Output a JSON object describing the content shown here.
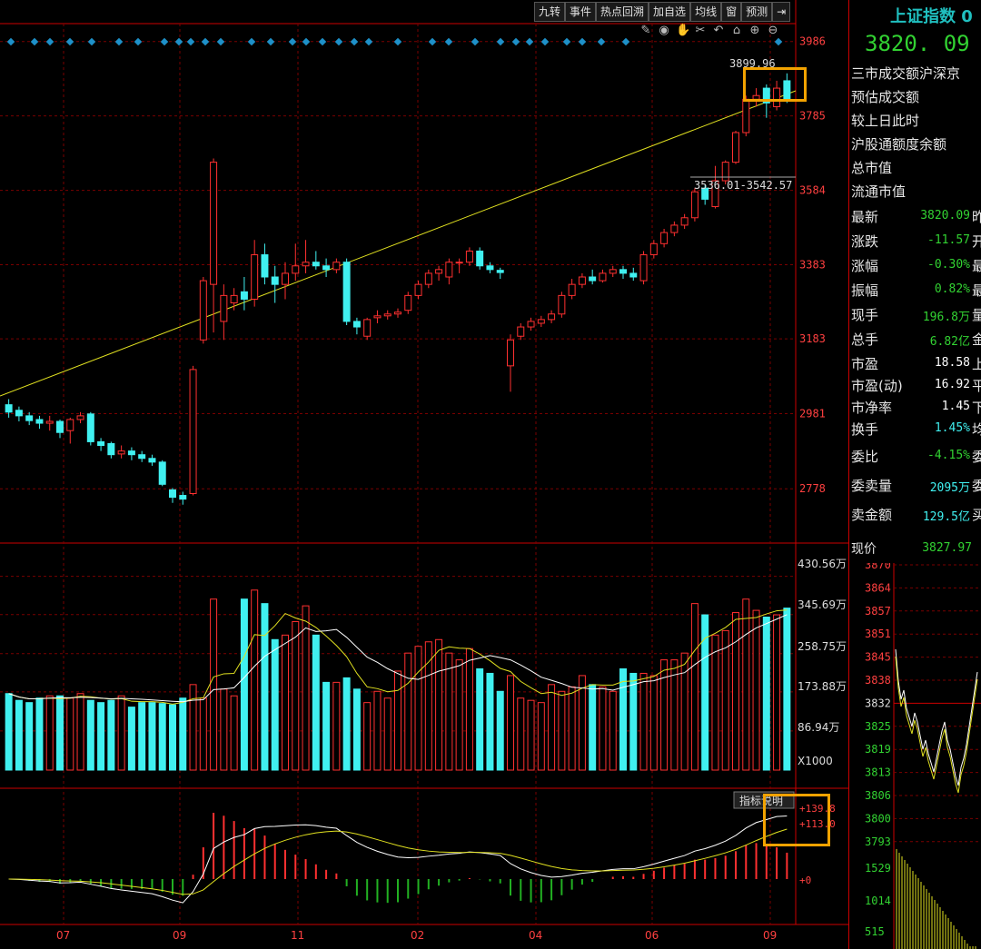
{
  "toolbar": [
    "九转",
    "事件",
    "热点回溯",
    "加自选",
    "均线",
    "窗",
    "预测"
  ],
  "tools": [
    "pen-icon",
    "eye-icon",
    "hand-icon",
    "scissors-icon",
    "undo-icon",
    "lock-icon",
    "zoom-in-icon",
    "zoom-out-icon"
  ],
  "colors": {
    "up": "#ff3030",
    "down": "#40f0f0",
    "green": "#32d232",
    "grid": "#7a0000",
    "ma1": "#ffffff",
    "ma2": "#e0e020"
  },
  "panel": {
    "title": "上证指数 0",
    "price": "3820. 09",
    "info_labels": [
      "三市成交额沪深京",
      "预估成交额",
      "较上日此时",
      "沪股通额度余额",
      "总市值",
      "流通市值"
    ],
    "quotes": [
      {
        "label": "最新",
        "value": "3820.09",
        "color": "green",
        "suffix": "昨"
      },
      {
        "label": "涨跌",
        "value": "-11.57",
        "color": "green",
        "suffix": "开"
      },
      {
        "label": "涨幅",
        "value": "-0.30%",
        "color": "green",
        "suffix": "最"
      },
      {
        "label": "振幅",
        "value": "0.82%",
        "color": "green",
        "suffix": "最"
      },
      {
        "label": "现手",
        "value": "196.8万",
        "color": "green",
        "suffix": "量"
      },
      {
        "label": "总手",
        "value": "6.82亿",
        "color": "green",
        "suffix": "金"
      },
      {
        "label": "市盈",
        "value": "18.58",
        "color": "white",
        "suffix": "上"
      },
      {
        "label": "市盈(动)",
        "value": "16.92",
        "color": "white",
        "suffix": "平"
      },
      {
        "label": "市净率",
        "value": "1.45",
        "color": "white",
        "suffix": "下"
      },
      {
        "label": "换手",
        "value": "1.45%",
        "color": "cyan",
        "suffix": "均"
      },
      {
        "label": "委比",
        "value": "-4.15%",
        "color": "green",
        "suffix": "委"
      },
      {
        "label": "委卖量",
        "value": "2095万",
        "color": "cyan",
        "suffix": "委"
      },
      {
        "label": "卖金额",
        "value": "129.5亿",
        "color": "cyan",
        "suffix": "买"
      }
    ],
    "mini_price_label": "现价",
    "mini_price": "3827.97",
    "mini_price_axis": [
      "3870",
      "3864",
      "3857",
      "3851",
      "3845",
      "3838",
      "3832",
      "3825",
      "3819",
      "3813",
      "3806",
      "3800",
      "3793"
    ],
    "mini_vol_axis": [
      "1529",
      "1014",
      "515"
    ]
  },
  "chart_data": {
    "type": "candlestick",
    "price_axis": [
      "3986",
      "3785",
      "3584",
      "3383",
      "3183",
      "2981",
      "2778"
    ],
    "price_range": [
      2700,
      4000
    ],
    "annotations": {
      "high_label": "3899.96",
      "gap_label": "3536.01-3542.57"
    },
    "x_labels": [
      "07",
      "09",
      "11",
      "02",
      "04",
      "06",
      "09"
    ],
    "volume_axis": [
      "430.56万",
      "345.69万",
      "258.75万",
      "173.88万",
      "86.94万",
      "X1000"
    ],
    "volume_range": [
      0,
      450
    ],
    "macd_labels": [
      "+139.8",
      "+113.0",
      "+0"
    ],
    "macd_button": "指标说明",
    "candles": [
      {
        "o": 3005,
        "c": 2985,
        "h": 3020,
        "l": 2970,
        "v": 170
      },
      {
        "o": 2990,
        "c": 2975,
        "h": 3000,
        "l": 2960,
        "v": 155
      },
      {
        "o": 2975,
        "c": 2962,
        "h": 2985,
        "l": 2950,
        "v": 150
      },
      {
        "o": 2965,
        "c": 2955,
        "h": 2975,
        "l": 2940,
        "v": 160
      },
      {
        "o": 2955,
        "c": 2960,
        "h": 2975,
        "l": 2935,
        "v": 165
      },
      {
        "o": 2960,
        "c": 2930,
        "h": 2965,
        "l": 2915,
        "v": 165
      },
      {
        "o": 2935,
        "c": 2965,
        "h": 2970,
        "l": 2900,
        "v": 160
      },
      {
        "o": 2965,
        "c": 2975,
        "h": 2985,
        "l": 2955,
        "v": 170
      },
      {
        "o": 2980,
        "c": 2905,
        "h": 2985,
        "l": 2895,
        "v": 155
      },
      {
        "o": 2905,
        "c": 2895,
        "h": 2915,
        "l": 2880,
        "v": 150
      },
      {
        "o": 2900,
        "c": 2870,
        "h": 2905,
        "l": 2860,
        "v": 155
      },
      {
        "o": 2872,
        "c": 2880,
        "h": 2895,
        "l": 2860,
        "v": 165
      },
      {
        "o": 2880,
        "c": 2870,
        "h": 2890,
        "l": 2855,
        "v": 140
      },
      {
        "o": 2870,
        "c": 2860,
        "h": 2880,
        "l": 2850,
        "v": 150
      },
      {
        "o": 2860,
        "c": 2850,
        "h": 2870,
        "l": 2840,
        "v": 150
      },
      {
        "o": 2850,
        "c": 2790,
        "h": 2855,
        "l": 2785,
        "v": 148
      },
      {
        "o": 2775,
        "c": 2755,
        "h": 2780,
        "l": 2740,
        "v": 145
      },
      {
        "o": 2760,
        "c": 2750,
        "h": 2770,
        "l": 2735,
        "v": 160
      },
      {
        "o": 2765,
        "c": 3100,
        "h": 3110,
        "l": 2760,
        "v": 190
      },
      {
        "o": 3180,
        "c": 3340,
        "h": 3350,
        "l": 3170,
        "v": 160
      },
      {
        "o": 3330,
        "c": 3660,
        "h": 3670,
        "l": 3200,
        "v": 380
      },
      {
        "o": 3230,
        "c": 3300,
        "h": 3330,
        "l": 3180,
        "v": 180
      },
      {
        "o": 3280,
        "c": 3300,
        "h": 3320,
        "l": 3260,
        "v": 165
      },
      {
        "o": 3310,
        "c": 3290,
        "h": 3350,
        "l": 3260,
        "v": 380
      },
      {
        "o": 3290,
        "c": 3410,
        "h": 3450,
        "l": 3270,
        "v": 400
      },
      {
        "o": 3410,
        "c": 3350,
        "h": 3440,
        "l": 3330,
        "v": 370
      },
      {
        "o": 3350,
        "c": 3330,
        "h": 3380,
        "l": 3280,
        "v": 290
      },
      {
        "o": 3330,
        "c": 3360,
        "h": 3390,
        "l": 3290,
        "v": 300
      },
      {
        "o": 3360,
        "c": 3380,
        "h": 3440,
        "l": 3340,
        "v": 330
      },
      {
        "o": 3380,
        "c": 3390,
        "h": 3450,
        "l": 3360,
        "v": 365
      },
      {
        "o": 3390,
        "c": 3380,
        "h": 3420,
        "l": 3370,
        "v": 300
      },
      {
        "o": 3380,
        "c": 3370,
        "h": 3400,
        "l": 3350,
        "v": 195
      },
      {
        "o": 3370,
        "c": 3390,
        "h": 3400,
        "l": 3360,
        "v": 195
      },
      {
        "o": 3390,
        "c": 3230,
        "h": 3400,
        "l": 3220,
        "v": 205
      },
      {
        "o": 3230,
        "c": 3215,
        "h": 3240,
        "l": 3195,
        "v": 180
      },
      {
        "o": 3190,
        "c": 3235,
        "h": 3240,
        "l": 3180,
        "v": 150
      },
      {
        "o": 3240,
        "c": 3245,
        "h": 3260,
        "l": 3225,
        "v": 175
      },
      {
        "o": 3245,
        "c": 3250,
        "h": 3260,
        "l": 3235,
        "v": 160
      },
      {
        "o": 3250,
        "c": 3255,
        "h": 3265,
        "l": 3240,
        "v": 220
      },
      {
        "o": 3260,
        "c": 3300,
        "h": 3310,
        "l": 3250,
        "v": 260
      },
      {
        "o": 3300,
        "c": 3330,
        "h": 3340,
        "l": 3290,
        "v": 275
      },
      {
        "o": 3330,
        "c": 3360,
        "h": 3370,
        "l": 3320,
        "v": 285
      },
      {
        "o": 3360,
        "c": 3370,
        "h": 3380,
        "l": 3340,
        "v": 290
      },
      {
        "o": 3350,
        "c": 3390,
        "h": 3400,
        "l": 3330,
        "v": 260
      },
      {
        "o": 3390,
        "c": 3390,
        "h": 3400,
        "l": 3360,
        "v": 245
      },
      {
        "o": 3390,
        "c": 3420,
        "h": 3430,
        "l": 3380,
        "v": 270
      },
      {
        "o": 3420,
        "c": 3380,
        "h": 3430,
        "l": 3370,
        "v": 225
      },
      {
        "o": 3380,
        "c": 3370,
        "h": 3390,
        "l": 3360,
        "v": 215
      },
      {
        "o": 3368,
        "c": 3362,
        "h": 3375,
        "l": 3345,
        "v": 175
      },
      {
        "o": 3110,
        "c": 3180,
        "h": 3195,
        "l": 3040,
        "v": 210
      },
      {
        "o": 3190,
        "c": 3215,
        "h": 3225,
        "l": 3180,
        "v": 160
      },
      {
        "o": 3215,
        "c": 3230,
        "h": 3240,
        "l": 3205,
        "v": 155
      },
      {
        "o": 3225,
        "c": 3235,
        "h": 3245,
        "l": 3215,
        "v": 150
      },
      {
        "o": 3235,
        "c": 3250,
        "h": 3260,
        "l": 3225,
        "v": 190
      },
      {
        "o": 3250,
        "c": 3300,
        "h": 3310,
        "l": 3240,
        "v": 175
      },
      {
        "o": 3300,
        "c": 3330,
        "h": 3345,
        "l": 3290,
        "v": 185
      },
      {
        "o": 3330,
        "c": 3350,
        "h": 3360,
        "l": 3320,
        "v": 210
      },
      {
        "o": 3350,
        "c": 3340,
        "h": 3370,
        "l": 3330,
        "v": 190
      },
      {
        "o": 3340,
        "c": 3360,
        "h": 3370,
        "l": 3335,
        "v": 185
      },
      {
        "o": 3360,
        "c": 3370,
        "h": 3380,
        "l": 3350,
        "v": 175
      },
      {
        "o": 3370,
        "c": 3360,
        "h": 3380,
        "l": 3345,
        "v": 225
      },
      {
        "o": 3360,
        "c": 3350,
        "h": 3375,
        "l": 3340,
        "v": 215
      },
      {
        "o": 3340,
        "c": 3410,
        "h": 3420,
        "l": 3330,
        "v": 215
      },
      {
        "o": 3410,
        "c": 3440,
        "h": 3450,
        "l": 3400,
        "v": 210
      },
      {
        "o": 3440,
        "c": 3470,
        "h": 3480,
        "l": 3430,
        "v": 245
      },
      {
        "o": 3470,
        "c": 3490,
        "h": 3500,
        "l": 3460,
        "v": 245
      },
      {
        "o": 3490,
        "c": 3510,
        "h": 3520,
        "l": 3480,
        "v": 260
      },
      {
        "o": 3510,
        "c": 3580,
        "h": 3590,
        "l": 3500,
        "v": 370
      },
      {
        "o": 3590,
        "c": 3560,
        "h": 3600,
        "l": 3545,
        "v": 345
      },
      {
        "o": 3540,
        "c": 3610,
        "h": 3650,
        "l": 3535,
        "v": 300
      },
      {
        "o": 3610,
        "c": 3660,
        "h": 3665,
        "l": 3600,
        "v": 310
      },
      {
        "o": 3660,
        "c": 3740,
        "h": 3745,
        "l": 3655,
        "v": 350
      },
      {
        "o": 3740,
        "c": 3830,
        "h": 3840,
        "l": 3730,
        "v": 380
      },
      {
        "o": 3830,
        "c": 3840,
        "h": 3860,
        "l": 3810,
        "v": 355
      },
      {
        "o": 3860,
        "c": 3820,
        "h": 3870,
        "l": 3780,
        "v": 340
      },
      {
        "o": 3810,
        "c": 3860,
        "h": 3880,
        "l": 3800,
        "v": 345
      },
      {
        "o": 3880,
        "c": 3830,
        "h": 3900,
        "l": 3820,
        "v": 360
      }
    ]
  }
}
